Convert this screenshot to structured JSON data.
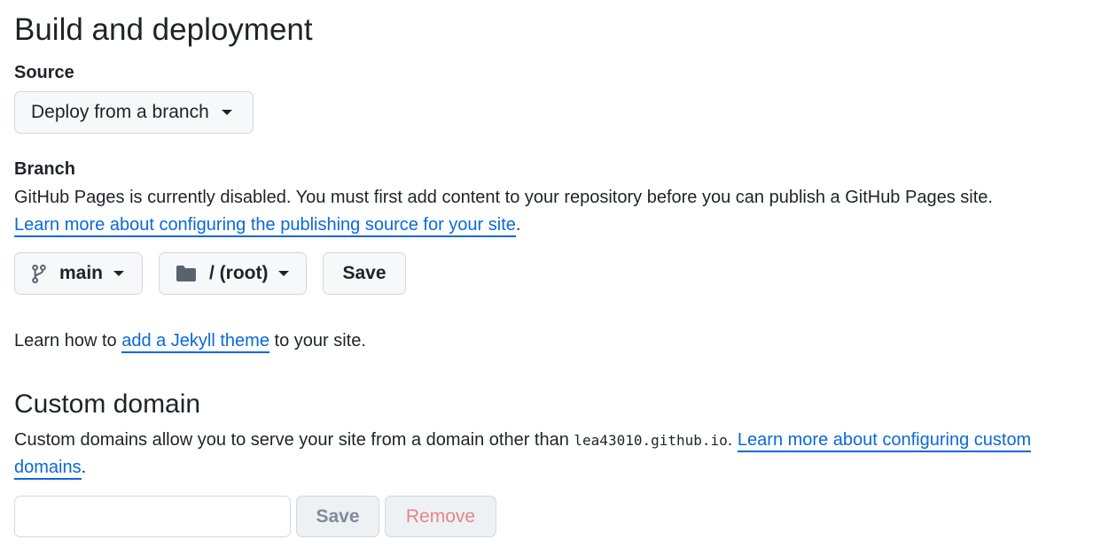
{
  "build": {
    "title": "Build and deployment",
    "source_label": "Source",
    "source_selected": "Deploy from a branch",
    "branch_label": "Branch",
    "disabled_text": "GitHub Pages is currently disabled. You must first add content to your repository before you can publish a GitHub Pages site.",
    "learn_link": "Learn more about configuring the publishing source for your site",
    "branch_selected": "main",
    "folder_selected": "/ (root)",
    "save_label": "Save",
    "jekyll_pre": "Learn how to ",
    "jekyll_link": "add a Jekyll theme",
    "jekyll_post": " to your site."
  },
  "custom_domain": {
    "title": "Custom domain",
    "desc_pre": "Custom domains allow you to serve your site from a domain other than ",
    "domain_code": "lea43010.github.io",
    "desc_mid": ". ",
    "learn_link": "Learn more about configuring custom domains",
    "desc_post": ".",
    "input_value": "",
    "save_label": "Save",
    "remove_label": "Remove"
  },
  "icons": {
    "branch": "git-branch-icon",
    "folder": "folder-icon",
    "caret": "triangle-down-icon"
  },
  "colors": {
    "link": "#0969da",
    "text": "#1f2328",
    "button_bg": "#f6f8fa",
    "border": "#d1d9e0",
    "disabled_text": "#818b98",
    "danger_disabled": "#e5858a"
  }
}
